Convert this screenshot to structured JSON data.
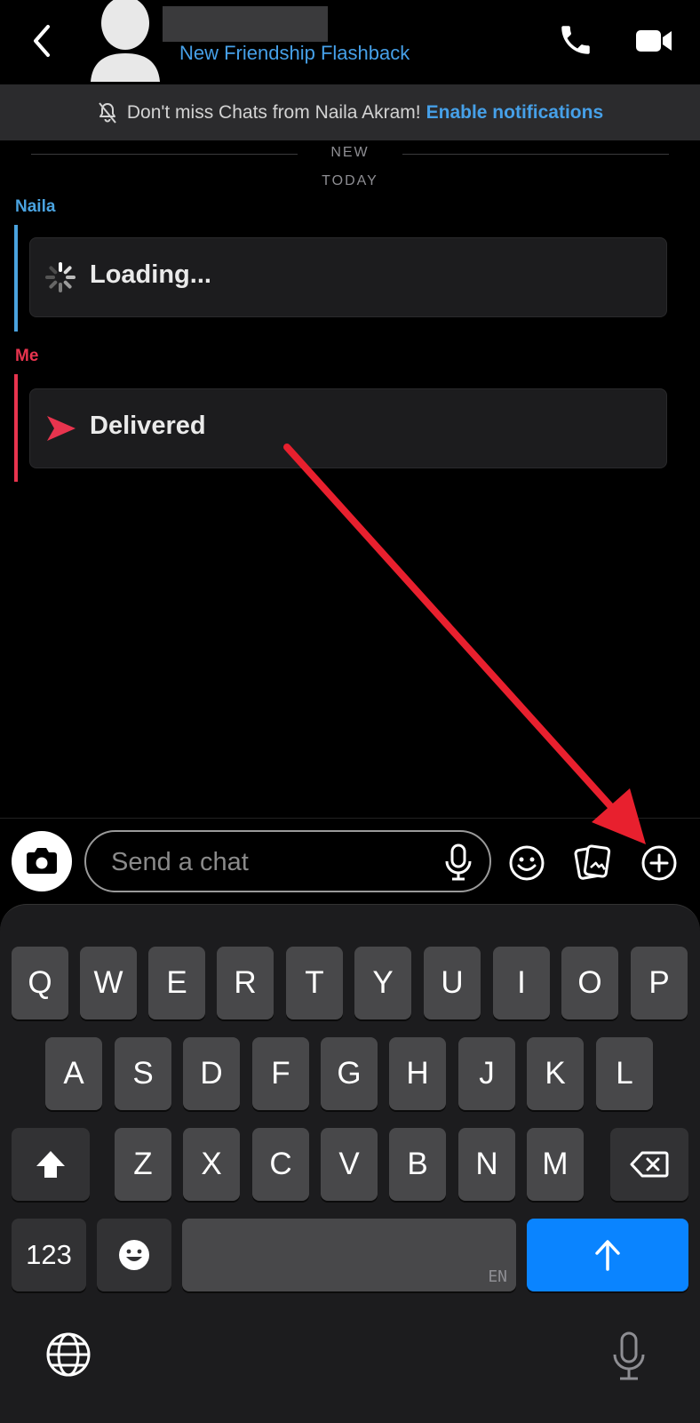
{
  "header": {
    "subtitle": "New Friendship Flashback",
    "back_icon": "chevron-left-icon",
    "avatar_icon": "person-silhouette-icon",
    "call_icon": "phone-icon",
    "video_icon": "video-camera-icon"
  },
  "notification": {
    "icon": "bell-off-icon",
    "message": "Don't miss Chats from Naila Akram!",
    "link": "Enable notifications"
  },
  "separators": {
    "new": "NEW",
    "today": "TODAY"
  },
  "messages": [
    {
      "sender": "Naila",
      "sender_color": "#4aa3e0",
      "status": "Loading...",
      "icon": "loading-spinner-icon"
    },
    {
      "sender": "Me",
      "sender_color": "#e8344e",
      "status": "Delivered",
      "icon": "delivered-arrow-icon"
    }
  ],
  "composer": {
    "placeholder": "Send a chat",
    "camera_icon": "camera-icon",
    "mic_icon": "microphone-icon",
    "emoji_icon": "smiley-icon",
    "memories_icon": "memories-cards-icon",
    "plus_icon": "plus-circle-icon"
  },
  "keyboard": {
    "row1": [
      "Q",
      "W",
      "E",
      "R",
      "T",
      "Y",
      "U",
      "I",
      "O",
      "P"
    ],
    "row2": [
      "A",
      "S",
      "D",
      "F",
      "G",
      "H",
      "J",
      "K",
      "L"
    ],
    "row3": [
      "Z",
      "X",
      "C",
      "V",
      "B",
      "N",
      "M"
    ],
    "numbers_key": "123",
    "space_language": "EN",
    "shift_icon": "shift-icon",
    "backspace_icon": "backspace-icon",
    "emoji_icon": "emoji-key-icon",
    "send_icon": "arrow-up-icon",
    "globe_icon": "globe-icon",
    "dictation_icon": "microphone-icon"
  },
  "colors": {
    "accent_blue": "#46a0e8",
    "me_red": "#e8344e",
    "send_blue": "#0a84ff",
    "annotation_arrow": "#e8202e"
  }
}
